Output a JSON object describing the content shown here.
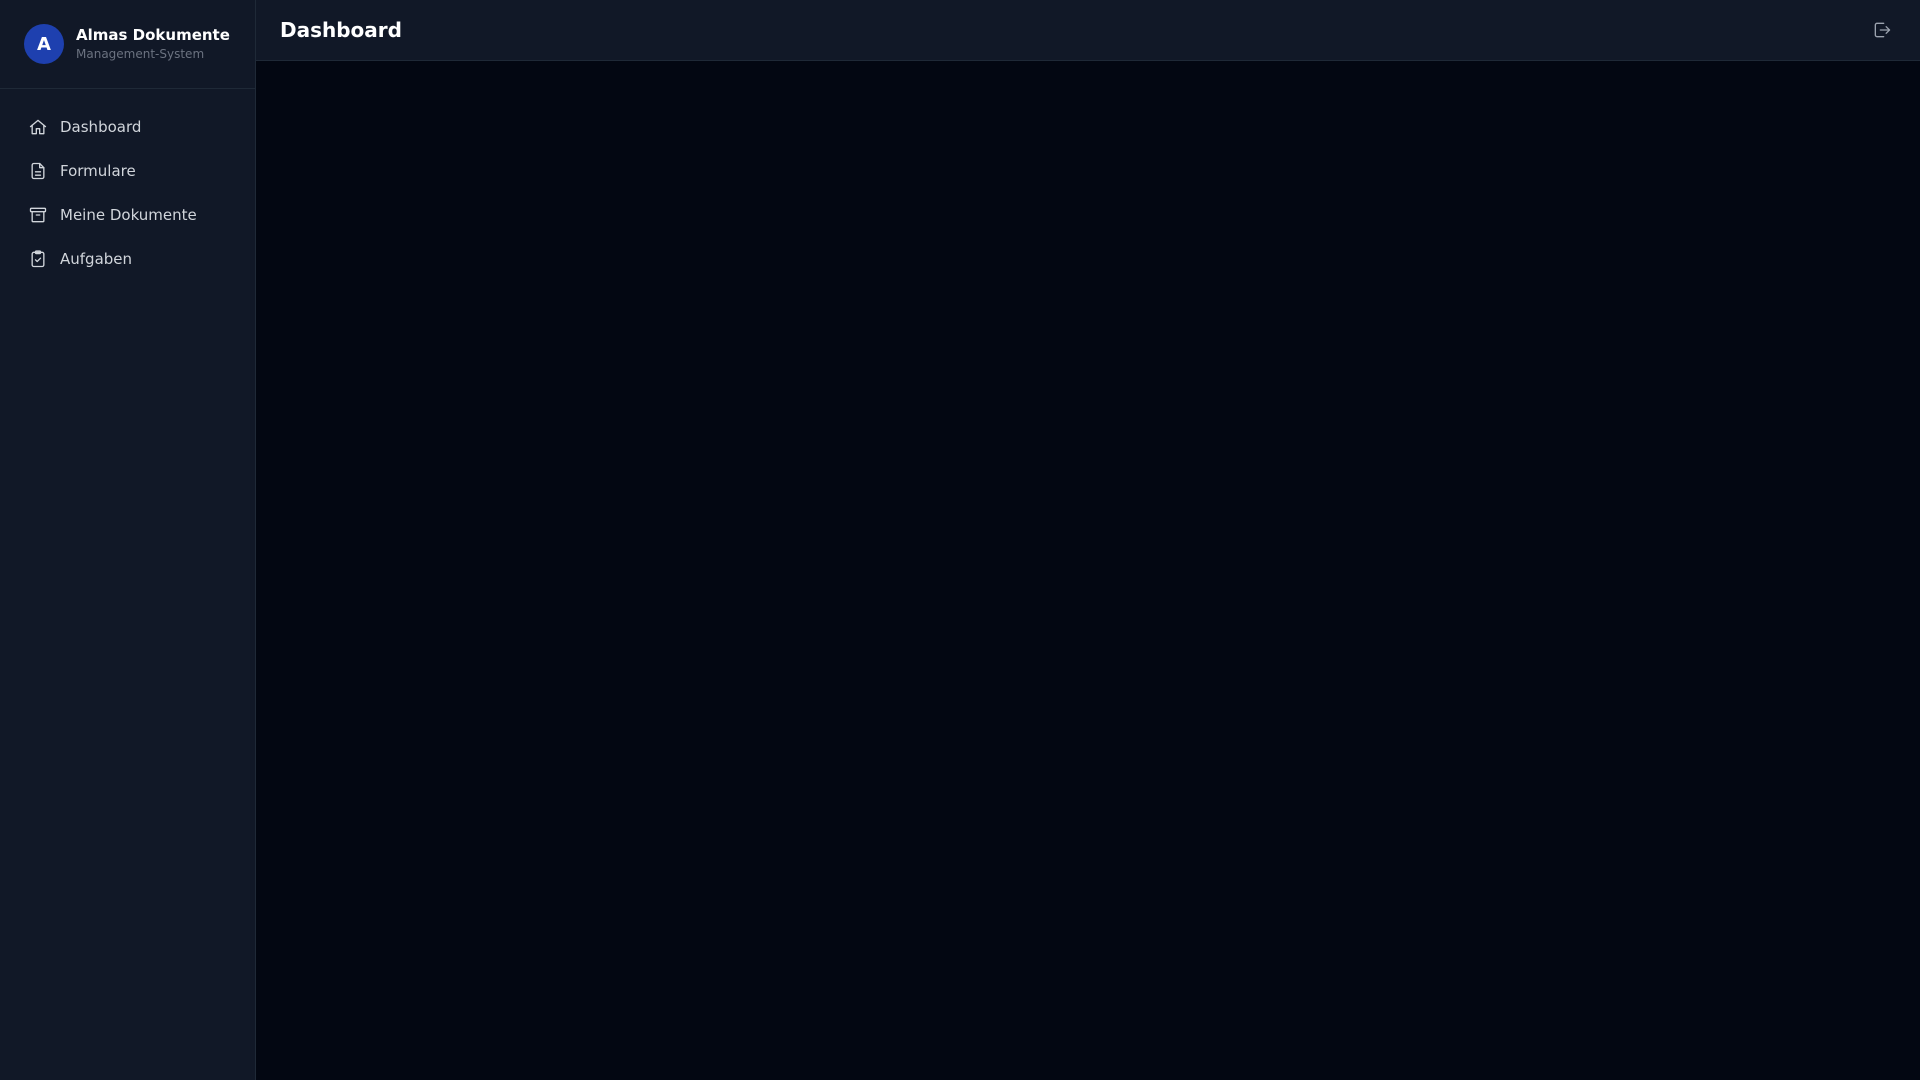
{
  "brand": {
    "avatar_letter": "A",
    "title": "Almas Dokumente",
    "subtitle": "Management-System",
    "avatar_color": "#1e40af"
  },
  "sidebar": {
    "items": [
      {
        "label": "Dashboard",
        "icon": "home-icon"
      },
      {
        "label": "Formulare",
        "icon": "document-text-icon"
      },
      {
        "label": "Meine Dokumente",
        "icon": "archive-icon"
      },
      {
        "label": "Aufgaben",
        "icon": "clipboard-check-icon"
      }
    ]
  },
  "header": {
    "title": "Dashboard",
    "logout_icon": "logout-icon"
  },
  "colors": {
    "background": "#030712",
    "panel": "#111827",
    "border": "#1f2937"
  }
}
